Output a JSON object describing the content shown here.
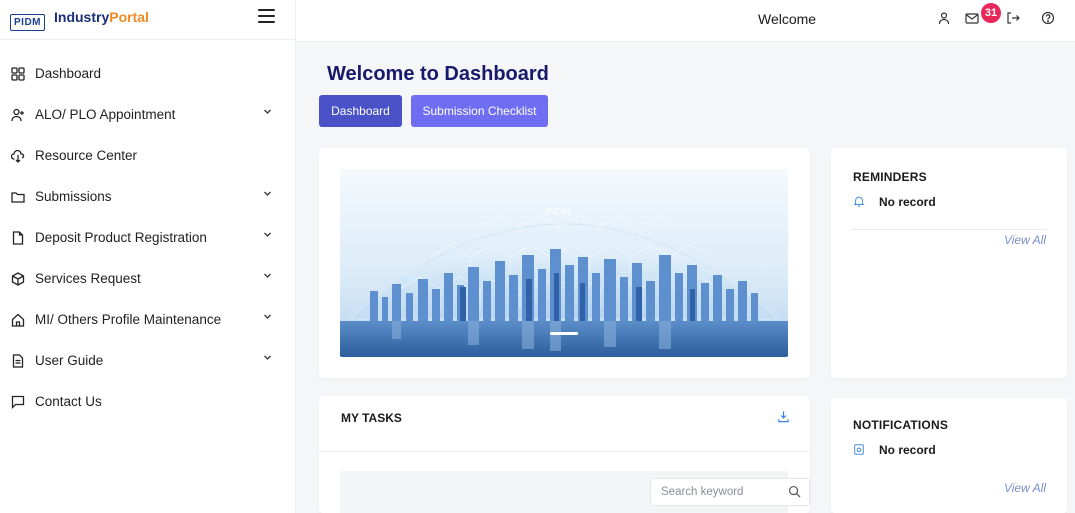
{
  "brand": {
    "logo_text": "PIDM",
    "name_primary": "Industry",
    "name_accent": "Portal"
  },
  "sidebar": {
    "items": [
      {
        "label": "Dashboard",
        "icon": "grid-icon",
        "has_submenu": false
      },
      {
        "label": "ALO/ PLO Appointment",
        "icon": "user-add-icon",
        "has_submenu": true
      },
      {
        "label": "Resource Center",
        "icon": "cloud-download-icon",
        "has_submenu": false
      },
      {
        "label": "Submissions",
        "icon": "folder-icon",
        "has_submenu": true
      },
      {
        "label": "Deposit Product Registration",
        "icon": "file-icon",
        "has_submenu": true
      },
      {
        "label": "Services Request",
        "icon": "box-icon",
        "has_submenu": true
      },
      {
        "label": "MI/ Others Profile Maintenance",
        "icon": "home-icon",
        "has_submenu": true
      },
      {
        "label": "User Guide",
        "icon": "document-icon",
        "has_submenu": true
      },
      {
        "label": "Contact Us",
        "icon": "chat-icon",
        "has_submenu": false
      }
    ]
  },
  "header": {
    "welcome": "Welcome",
    "mail_badge": "31",
    "icons": [
      "user-icon",
      "mail-icon",
      "logout-icon",
      "help-icon"
    ]
  },
  "main": {
    "title": "Welcome to Dashboard",
    "buttons": {
      "dashboard": "Dashboard",
      "checklist": "Submission Checklist"
    },
    "banner": {
      "watermark": "PIDM"
    },
    "reminders": {
      "heading": "REMINDERS",
      "empty": "No record",
      "view_all": "View All"
    },
    "notifications": {
      "heading": "NOTIFICATIONS",
      "empty": "No record",
      "view_all": "View All"
    },
    "tasks": {
      "heading": "MY TASKS",
      "search_placeholder": "Search keyword"
    }
  },
  "colors": {
    "primary_button": "#4a52c8",
    "secondary_button": "#6f6ef3",
    "title": "#18196b",
    "badge": "#e8285a",
    "link": "#7a8fc9"
  }
}
